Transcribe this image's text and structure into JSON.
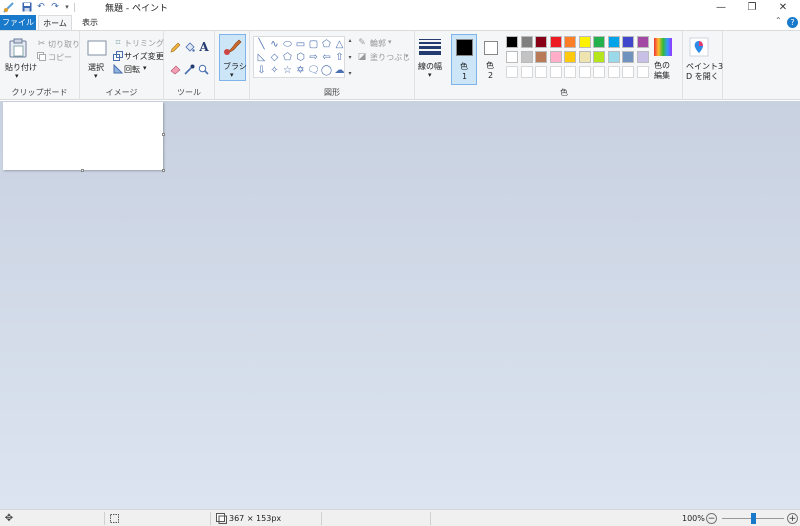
{
  "window": {
    "title": "無題 - ペイント",
    "minimize_icon": "—",
    "restore_icon": "❐",
    "close_icon": "✕"
  },
  "quick_access": {
    "app_icon": "paint-brush-logo",
    "save_icon": "floppy",
    "undo_icon": "↶",
    "redo_icon": "↷",
    "customize_icon": "▾"
  },
  "tabs": [
    {
      "label": "ファイル"
    },
    {
      "label": "ホーム"
    },
    {
      "label": "表示"
    }
  ],
  "help_label": "?",
  "ribbon": {
    "clipboard": {
      "paste_label": "貼り付け",
      "cut_label": "切り取り",
      "copy_label": "コピー",
      "group_label": "クリップボード"
    },
    "image": {
      "select_label": "選択",
      "crop_label": "トリミング",
      "resize_label": "サイズ変更",
      "rotate_label": "回転",
      "group_label": "イメージ"
    },
    "tools": {
      "text_tool_glyph": "A",
      "group_label": "ツール"
    },
    "brushes": {
      "label": "ブラシ"
    },
    "shapes": {
      "row1": [
        "╲",
        "∿",
        "⬭",
        "▭",
        "▢",
        "⬠",
        "△"
      ],
      "row2": [
        "◺",
        "◇",
        "⬠",
        "⬡",
        "⇨",
        "⇦",
        "⇧"
      ],
      "row3": [
        "⇩",
        "✧",
        "☆",
        "✡",
        "🗨",
        "◯",
        "☁"
      ],
      "outline_label": "輪郭",
      "fill_label": "塗りつぶし",
      "group_label": "図形"
    },
    "size": {
      "label": "線の幅"
    },
    "colors": {
      "color1_label": "色",
      "color1_num": "1",
      "color1_value": "#000000",
      "color2_label": "色",
      "color2_num": "2",
      "color2_value": "#ffffff",
      "palette_row1": [
        "#000000",
        "#7f7f7f",
        "#880015",
        "#ed1c24",
        "#ff7f27",
        "#fff200",
        "#22b14c",
        "#00a2e8",
        "#3f48cc",
        "#a349a4"
      ],
      "palette_row2": [
        "#ffffff",
        "#c3c3c3",
        "#b97a57",
        "#ffaec9",
        "#ffc90e",
        "#efe4b0",
        "#b5e61d",
        "#99d9ea",
        "#7092be",
        "#c8bfe7"
      ],
      "palette_row3": [
        "#ffffff",
        "#ffffff",
        "#ffffff",
        "#ffffff",
        "#ffffff",
        "#ffffff",
        "#ffffff",
        "#ffffff",
        "#ffffff",
        "#ffffff"
      ],
      "edit_label_1": "色の",
      "edit_label_2": "編集",
      "group_label": "色"
    },
    "paint3d": {
      "label_1": "ペイント3",
      "label_2": "D を開く"
    }
  },
  "status": {
    "canvas_size": "367 × 153px",
    "zoom": "100%",
    "zoom_level_percent": 100,
    "zoom_out": "−",
    "zoom_in": "+"
  }
}
